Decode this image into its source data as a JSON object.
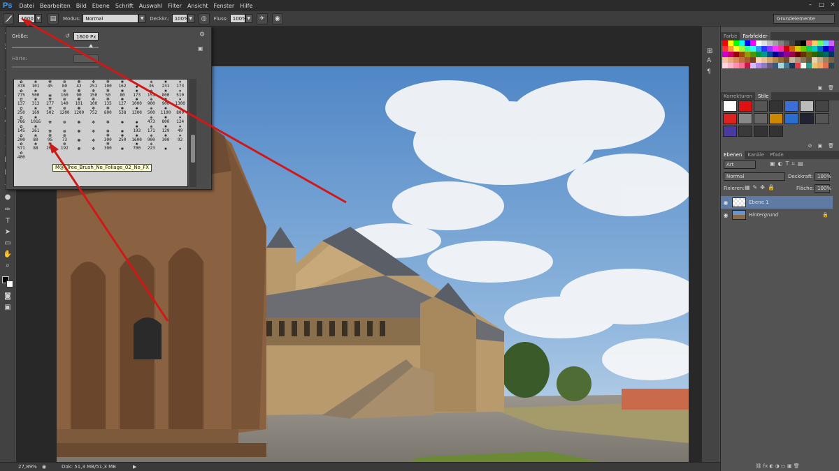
{
  "app": {
    "logo": "Ps"
  },
  "menu": [
    "Datei",
    "Bearbeiten",
    "Bild",
    "Ebene",
    "Schrift",
    "Auswahl",
    "Filter",
    "Ansicht",
    "Fenster",
    "Hilfe"
  ],
  "window_controls": {
    "minimize": "–",
    "maximize": "□",
    "close": "✕"
  },
  "options_bar": {
    "brush_size_value": "1600",
    "modus_label": "Modus:",
    "modus_value": "Normal",
    "deckkraft_label": "Deckkr.:",
    "deckkraft_value": "100%",
    "fluss_label": "Fluss:",
    "fluss_value": "100%",
    "workspace": "Grundelemente"
  },
  "brush_picker": {
    "size_label": "Größe:",
    "size_value": "1600 Px",
    "hardness_label": "Härte:",
    "tooltip": "M@_Tree_Brush_No_Foliage_02_No_FX",
    "cells": [
      "378",
      "101",
      "45",
      "80",
      "42",
      "251",
      "100",
      "162",
      "",
      "36",
      "231",
      "173",
      "775",
      "500",
      "",
      "160",
      "90",
      "150",
      "50",
      "80",
      "173",
      "151",
      "800",
      "510",
      "137",
      "313",
      "277",
      "140",
      "101",
      "100",
      "135",
      "127",
      "1000",
      "900",
      "900",
      "1300",
      "250",
      "169",
      "502",
      "1200",
      "1200",
      "752",
      "600",
      "538",
      "1300",
      "500",
      "1100",
      "800",
      "786",
      "1016",
      "",
      "",
      "",
      "",
      "",
      "",
      "",
      "473",
      "800",
      "124",
      "145",
      "261",
      "",
      "",
      "",
      "",
      "",
      "",
      "193",
      "171",
      "129",
      "49",
      "200",
      "80",
      "95",
      "73",
      "",
      "",
      "300",
      "250",
      "1600",
      "900",
      "300",
      "92",
      "571",
      "88",
      "200",
      "192",
      "",
      "",
      "300",
      "",
      "700",
      "223",
      "",
      "",
      "400"
    ],
    "glyphs": [
      "✿",
      "❀",
      "✾",
      "❁",
      "✽",
      "✻",
      "❃",
      "✺",
      "✹",
      "❋",
      "✸",
      "✷"
    ]
  },
  "status_bar": {
    "zoom": "27,89%",
    "doc": "Dok: 51,3 MB/51,3 MB"
  },
  "panels": {
    "color_tabs": [
      "Farbe",
      "Farbfelder"
    ],
    "adjust_tabs": [
      "Korrekturen",
      "Stile"
    ],
    "layer_tabs": [
      "Ebenen",
      "Kanäle",
      "Pfade"
    ],
    "layer_filter": "Art",
    "blend_mode": "Normal",
    "opacity_label": "Deckkraft:",
    "opacity_value": "100%",
    "lock_label": "Fixieren:",
    "fill_label": "Fläche:",
    "fill_value": "100%",
    "layers": [
      {
        "name": "Ebene 1",
        "active": true
      },
      {
        "name": "Hintergrund",
        "active": false
      }
    ],
    "footer_icons": "⛓  fx  ◐  ◑  ▭  ▣  🗑"
  },
  "swatch_colors": [
    "#ff0000",
    "#ffff00",
    "#00ff00",
    "#00ffff",
    "#0000ff",
    "#ff00ff",
    "#ffffff",
    "#e0e0e0",
    "#c0c0c0",
    "#a0a0a0",
    "#808080",
    "#606060",
    "#404040",
    "#202020",
    "#000000",
    "#ff6666",
    "#ffcc66",
    "#66ff66",
    "#66ccff",
    "#cc66ff",
    "#ff3333",
    "#ff9933",
    "#ffff33",
    "#99ff33",
    "#33ff99",
    "#33ffff",
    "#3399ff",
    "#3333ff",
    "#9933ff",
    "#ff33ff",
    "#ff3399",
    "#cc0000",
    "#cc6600",
    "#cccc00",
    "#66cc00",
    "#00cc66",
    "#00cccc",
    "#0066cc",
    "#0000cc",
    "#6600cc",
    "#cc00cc",
    "#cc0066",
    "#990000",
    "#994c00",
    "#999900",
    "#4c9900",
    "#00994c",
    "#009999",
    "#004c99",
    "#000099",
    "#4c0099",
    "#990099",
    "#99004c",
    "#660000",
    "#663300",
    "#666600",
    "#336600",
    "#006633",
    "#006666",
    "#003366",
    "#f4c2a1",
    "#e8a87c",
    "#d98c5f",
    "#c26e3f",
    "#a35a2d",
    "#7a4120",
    "#f9d9b4",
    "#eac38e",
    "#d4a76a",
    "#b8894a",
    "#96693a",
    "#704d2a",
    "#c9b59a",
    "#a89478",
    "#877358",
    "#665538",
    "#e6d2b5",
    "#c2ab86",
    "#9e855f",
    "#7a6242",
    "#ffd6e0",
    "#ffb3c6",
    "#ff8fab",
    "#fb6f92",
    "#c9184a",
    "#d8bbff",
    "#b388eb",
    "#8e7dbe",
    "#6c5b7b",
    "#355c7d",
    "#a8dadc",
    "#457b9d",
    "#1d3557",
    "#e63946",
    "#f1faee",
    "#2a9d8f",
    "#e9c46a",
    "#f4a261",
    "#e76f51",
    "#264653"
  ],
  "style_colors": [
    "#ffffff",
    "#d11",
    "#555",
    "#333",
    "#3a6fd8",
    "#bbb",
    "#444",
    "#d22",
    "#888",
    "#666",
    "#c80",
    "#2a6fd0",
    "#223",
    "#555",
    "#4a3aa0",
    "#3a3a3a",
    "#333",
    "#333"
  ]
}
